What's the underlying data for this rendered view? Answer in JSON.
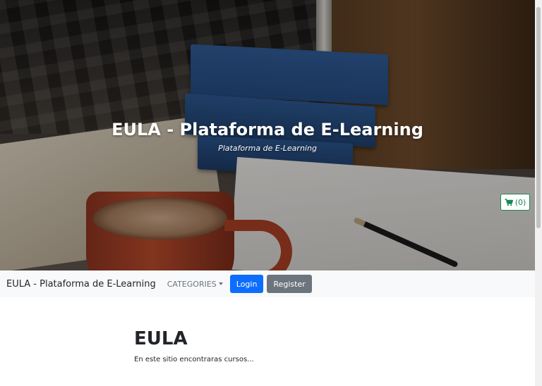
{
  "hero": {
    "title": "EULA - Plataforma de E-Learning",
    "subtitle": "Plataforma de E-Learning",
    "cart": {
      "icon": "cart-icon",
      "count_label": "(0)"
    }
  },
  "navbar": {
    "brand": "EULA - Plataforma de E-Learning",
    "categories_label": "CATEGORIES",
    "login_label": "Login",
    "register_label": "Register"
  },
  "content": {
    "title": "EULA",
    "description": "En este sitio encontraras cursos..."
  },
  "colors": {
    "primary": "#0d6efd",
    "secondary": "#6c757d",
    "success": "#198754",
    "navbar_bg": "#f8f9fa"
  }
}
